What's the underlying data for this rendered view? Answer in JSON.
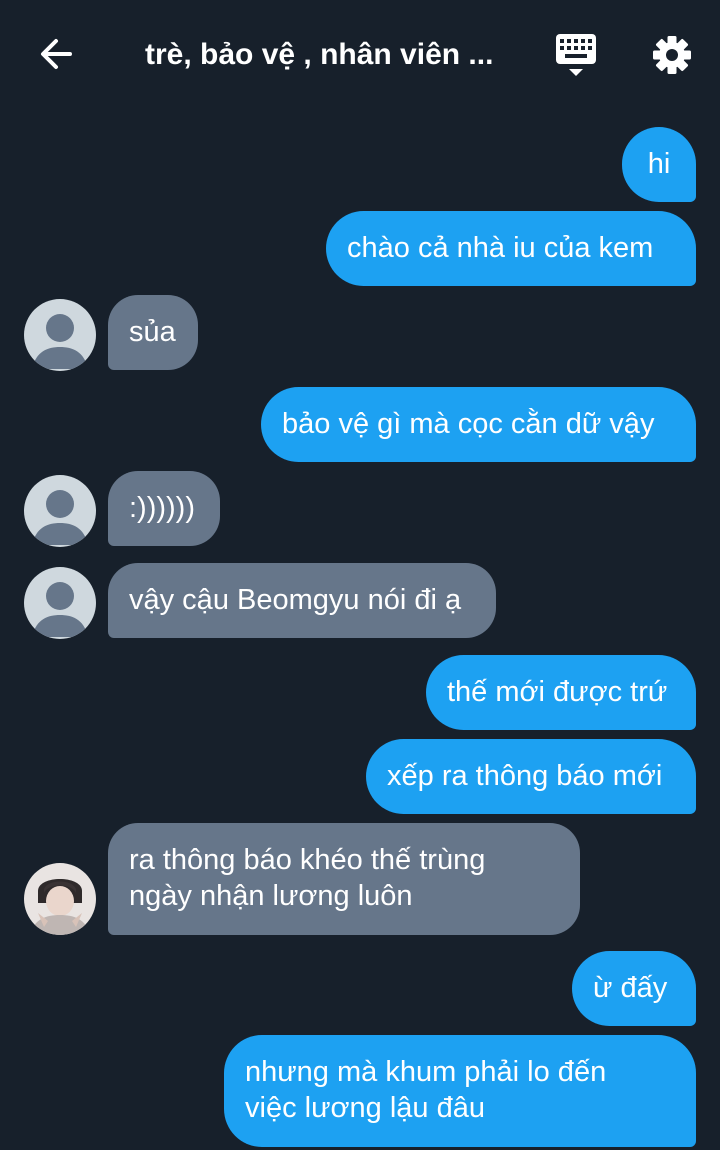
{
  "header": {
    "title": "trè, bảo vệ , nhân viên ...",
    "back_icon": "arrow-left-icon",
    "keyboard_icon": "keyboard-icon",
    "settings_icon": "gear-icon"
  },
  "colors": {
    "background": "#17202b",
    "outgoing_bubble": "#1da1f2",
    "incoming_bubble": "#66768a",
    "text": "#ffffff"
  },
  "messages": [
    {
      "direction": "out",
      "text": "hi"
    },
    {
      "direction": "out",
      "text": "chào cả nhà iu của kem"
    },
    {
      "direction": "in",
      "avatar": "default-avatar",
      "text": "sủa"
    },
    {
      "direction": "out",
      "text": "bảo vệ gì mà cọc cằn dữ vậy"
    },
    {
      "direction": "in",
      "avatar": "default-avatar",
      "text": ":))))))"
    },
    {
      "direction": "in",
      "avatar": "default-avatar",
      "text": "vậy cậu Beomgyu nói đi ạ"
    },
    {
      "direction": "out",
      "text": "thế mới được trứ"
    },
    {
      "direction": "out",
      "text": "xếp ra thông báo mới"
    },
    {
      "direction": "in",
      "avatar": "photo-avatar",
      "lines": [
        "ra thông báo khéo thế trùng",
        "ngày nhận lương luôn"
      ]
    },
    {
      "direction": "out",
      "text": "ừ đấy"
    },
    {
      "direction": "out",
      "lines": [
        "nhưng mà khum phải lo đến",
        "việc lương lậu đâu"
      ]
    }
  ]
}
